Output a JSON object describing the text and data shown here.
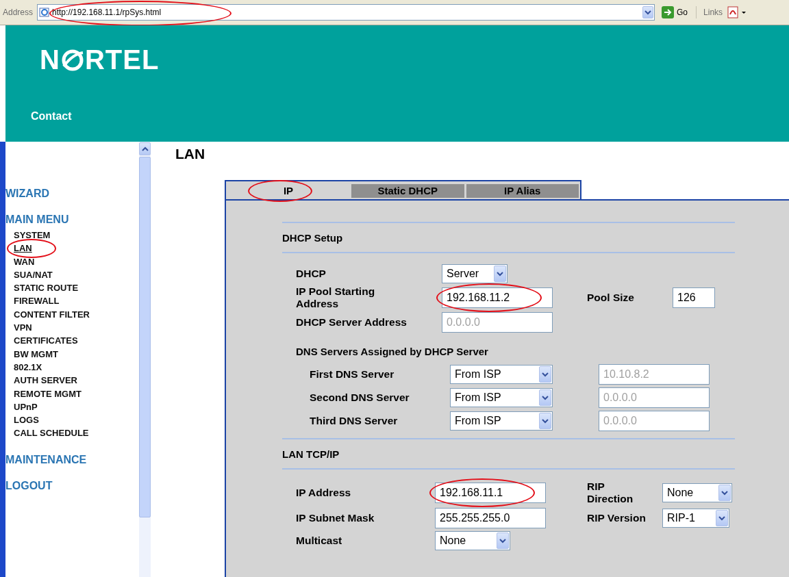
{
  "address_bar": {
    "label": "Address",
    "url": "http://192.168.11.1/rpSys.html",
    "circled": true,
    "go": "Go",
    "links": "Links"
  },
  "header": {
    "logo_left": "N",
    "logo_right": "RTEL",
    "contact": "Contact"
  },
  "sidebar": {
    "sections": [
      {
        "title": "WIZARD"
      },
      {
        "title": "MAIN MENU",
        "items": [
          {
            "label": "SYSTEM",
            "selected": false,
            "circled": false
          },
          {
            "label": "LAN",
            "selected": true,
            "circled": true
          },
          {
            "label": "WAN",
            "selected": false,
            "circled": false
          },
          {
            "label": "SUA/NAT",
            "selected": false,
            "circled": false
          },
          {
            "label": "STATIC ROUTE",
            "selected": false,
            "circled": false
          },
          {
            "label": "FIREWALL",
            "selected": false,
            "circled": false
          },
          {
            "label": "CONTENT FILTER",
            "selected": false,
            "circled": false
          },
          {
            "label": "VPN",
            "selected": false,
            "circled": false
          },
          {
            "label": "CERTIFICATES",
            "selected": false,
            "circled": false
          },
          {
            "label": "BW MGMT",
            "selected": false,
            "circled": false
          },
          {
            "label": "802.1X",
            "selected": false,
            "circled": false
          },
          {
            "label": "AUTH SERVER",
            "selected": false,
            "circled": false
          },
          {
            "label": "REMOTE MGMT",
            "selected": false,
            "circled": false
          },
          {
            "label": "UPnP",
            "selected": false,
            "circled": false
          },
          {
            "label": "LOGS",
            "selected": false,
            "circled": false
          },
          {
            "label": "CALL SCHEDULE",
            "selected": false,
            "circled": false
          }
        ]
      },
      {
        "title": "MAINTENANCE"
      },
      {
        "title": "LOGOUT"
      }
    ]
  },
  "page_title": "LAN",
  "tabs": [
    {
      "label": "IP",
      "selected": true,
      "circled": true
    },
    {
      "label": "Static DHCP",
      "selected": false,
      "circled": false
    },
    {
      "label": "IP Alias",
      "selected": false,
      "circled": false
    }
  ],
  "dhcp_setup": {
    "title": "DHCP Setup",
    "dhcp": {
      "label": "DHCP",
      "kind": "select",
      "value": "Server"
    },
    "pool_start": {
      "label": "IP Pool Starting Address",
      "kind": "text",
      "value": "192.168.11.2",
      "disabled": false,
      "circled": true
    },
    "pool_size": {
      "label": "Pool Size",
      "kind": "text",
      "value": "126",
      "disabled": false
    },
    "server_address": {
      "label": "DHCP Server Address",
      "kind": "text",
      "value": "0.0.0.0",
      "disabled": true
    }
  },
  "dns": {
    "title": "DNS Servers Assigned by DHCP Server",
    "rows": [
      {
        "label": "First DNS Server",
        "source": "From ISP",
        "address": "10.10.8.2",
        "disabled": true
      },
      {
        "label": "Second DNS Server",
        "source": "From ISP",
        "address": "0.0.0.0",
        "disabled": true
      },
      {
        "label": "Third DNS Server",
        "source": "From ISP",
        "address": "0.0.0.0",
        "disabled": true
      }
    ]
  },
  "lan_tcpip": {
    "title": "LAN TCP/IP",
    "ip_address": {
      "label": "IP Address",
      "kind": "text",
      "value": "192.168.11.1",
      "disabled": false,
      "circled": true
    },
    "rip_direction": {
      "label": "RIP Direction",
      "kind": "select",
      "value": "None"
    },
    "subnet_mask": {
      "label": "IP Subnet Mask",
      "kind": "text",
      "value": "255.255.255.0",
      "disabled": false
    },
    "rip_version": {
      "label": "RIP Version",
      "kind": "select",
      "value": "RIP-1"
    },
    "multicast": {
      "label": "Multicast",
      "kind": "select",
      "value": "None"
    }
  }
}
